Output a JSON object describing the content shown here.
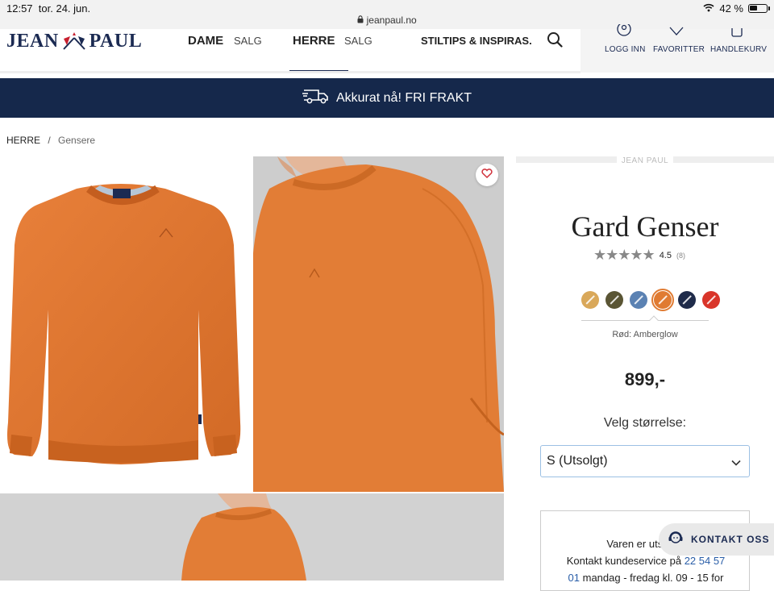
{
  "status_bar": {
    "time": "12:57",
    "date": "tor. 24. jun.",
    "url": "jeanpaul.no",
    "battery": "42 %"
  },
  "header": {
    "logo_left": "JEAN",
    "logo_right": "PAUL",
    "nav": {
      "dame": "DAME",
      "dame_sale": "SALG",
      "herre": "HERRE",
      "herre_sale": "SALG",
      "stiltips": "STILTIPS & INSPIRAS."
    },
    "account": {
      "login": "LOGG INN",
      "favorites": "FAVORITTER",
      "cart": "HANDLEKURV"
    }
  },
  "banner": {
    "text": "Akkurat nå! FRI FRAKT"
  },
  "breadcrumb": {
    "parent": "HERRE",
    "separator": "/",
    "current": "Gensere"
  },
  "product": {
    "brand": "JEAN PAUL",
    "title": "Gard Genser",
    "rating": 4.5,
    "rating_text": "4.5",
    "review_count": "(8)",
    "swatches": [
      "#d9a85a",
      "#5a5534",
      "#5b82b3",
      "#e07b32",
      "#1f2b4a",
      "#d9352a"
    ],
    "selected_swatch": 3,
    "color_name": "Rød: Amberglow",
    "price": "899,-",
    "size_label": "Velg størrelse:",
    "size_value": "S (Utsolgt)",
    "stock_line1": "Varen er utsolgt i",
    "stock_line2a": "Kontakt kundeservice på",
    "stock_phone_a": "22 54 57",
    "stock_phone_b": "01",
    "stock_line3": "mandag - fredag kl. 09 - 15 for"
  },
  "chat": {
    "label": "KONTAKT OSS"
  },
  "colors": {
    "navy": "#15284b",
    "orange": "#e07b32"
  }
}
